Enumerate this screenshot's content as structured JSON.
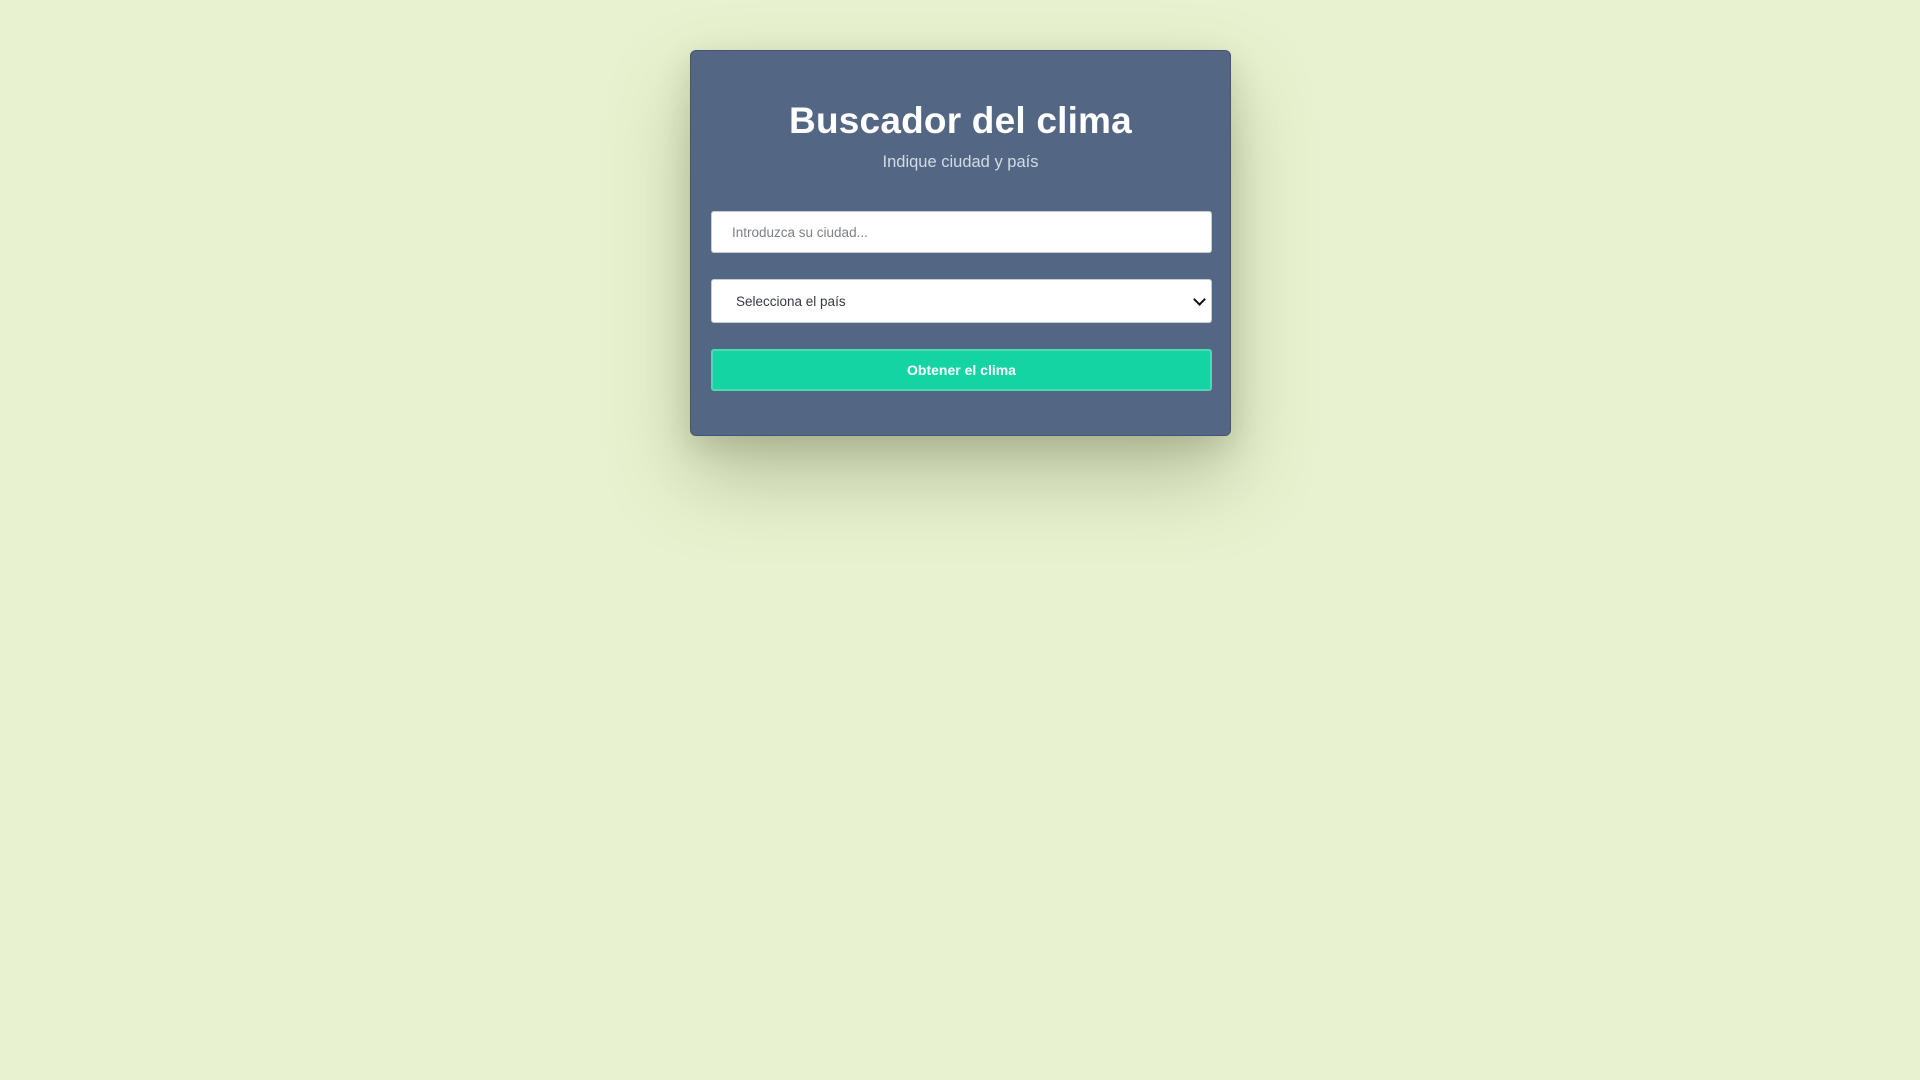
{
  "form": {
    "title": "Buscador del clima",
    "subtitle": "Indique ciudad y país",
    "city_input": {
      "placeholder": "Introduzca su ciudad...",
      "value": ""
    },
    "country_select": {
      "selected_label": "Selecciona el país"
    },
    "submit_label": "Obtener el clima"
  },
  "colors": {
    "background": "#e8f2d0",
    "card": "#536684",
    "button": "#14d4a4"
  },
  "icons": {
    "select_arrow": "chevron-down-icon"
  }
}
